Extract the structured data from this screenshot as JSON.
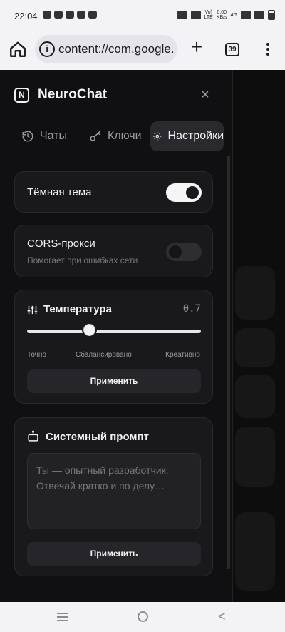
{
  "status_bar": {
    "time": "22:04",
    "network_top": "Vo)",
    "network_bottom": "LTE",
    "speed_top": "0.00",
    "speed_bottom": "KB/s",
    "signal_label": "4G"
  },
  "browser": {
    "url": "content://com.google.",
    "tab_count": "39"
  },
  "app": {
    "logo_letter": "N",
    "name": "NeuroChat"
  },
  "tabs": [
    {
      "label": "Чаты",
      "icon": "history-icon",
      "active": false
    },
    {
      "label": "Ключи",
      "icon": "key-icon",
      "active": false
    },
    {
      "label": "Настройки",
      "icon": "gear-icon",
      "active": true
    }
  ],
  "settings": {
    "dark_theme": {
      "label": "Тёмная тема",
      "enabled": true
    },
    "cors_proxy": {
      "label": "CORS-прокси",
      "hint": "Помогает при ошибках сети",
      "enabled": false
    },
    "temperature": {
      "label": "Температура",
      "value": "0.7",
      "value_fraction": 0.36,
      "scale_left": "Точно",
      "scale_mid": "Сбалансировано",
      "scale_right": "Креативно",
      "apply_label": "Применить"
    },
    "system_prompt": {
      "label": "Системный промпт",
      "placeholder_line1": "Ты — опытный разработчик.",
      "placeholder_line2": "Отвечай кратко и по делу…",
      "apply_label": "Применить"
    }
  },
  "colors": {
    "background": "#0d0d0e",
    "card": "#19191b",
    "accent": "#f5f5f6"
  }
}
